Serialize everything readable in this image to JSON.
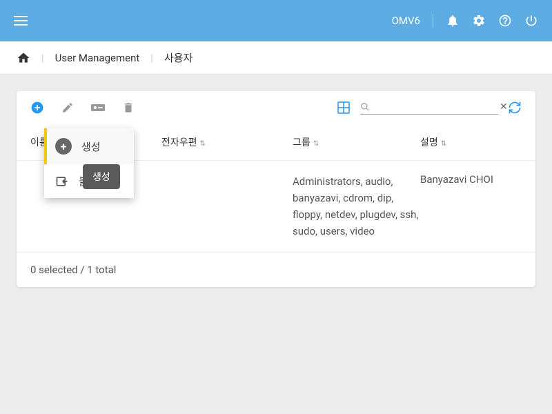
{
  "topbar": {
    "title": "OMV6"
  },
  "breadcrumb": {
    "section": "User Management",
    "page": "사용자"
  },
  "toolbar": {
    "search_placeholder": ""
  },
  "dropdown": {
    "create_label": "생성",
    "import_label": "불러오기",
    "tooltip": "생성"
  },
  "columns": {
    "name": "이름",
    "email": "전자우편",
    "groups": "그룹",
    "desc": "설명"
  },
  "rows": [
    {
      "name": "",
      "email": "",
      "groups": "Administrators, audio, banyazavi, cdrom, dip, floppy, netdev, plugdev, ssh, sudo, users, video",
      "desc": "Banyazavi CHOI"
    }
  ],
  "footer": {
    "status": "0 selected / 1 total"
  },
  "colors": {
    "accent": "#2196f3"
  }
}
